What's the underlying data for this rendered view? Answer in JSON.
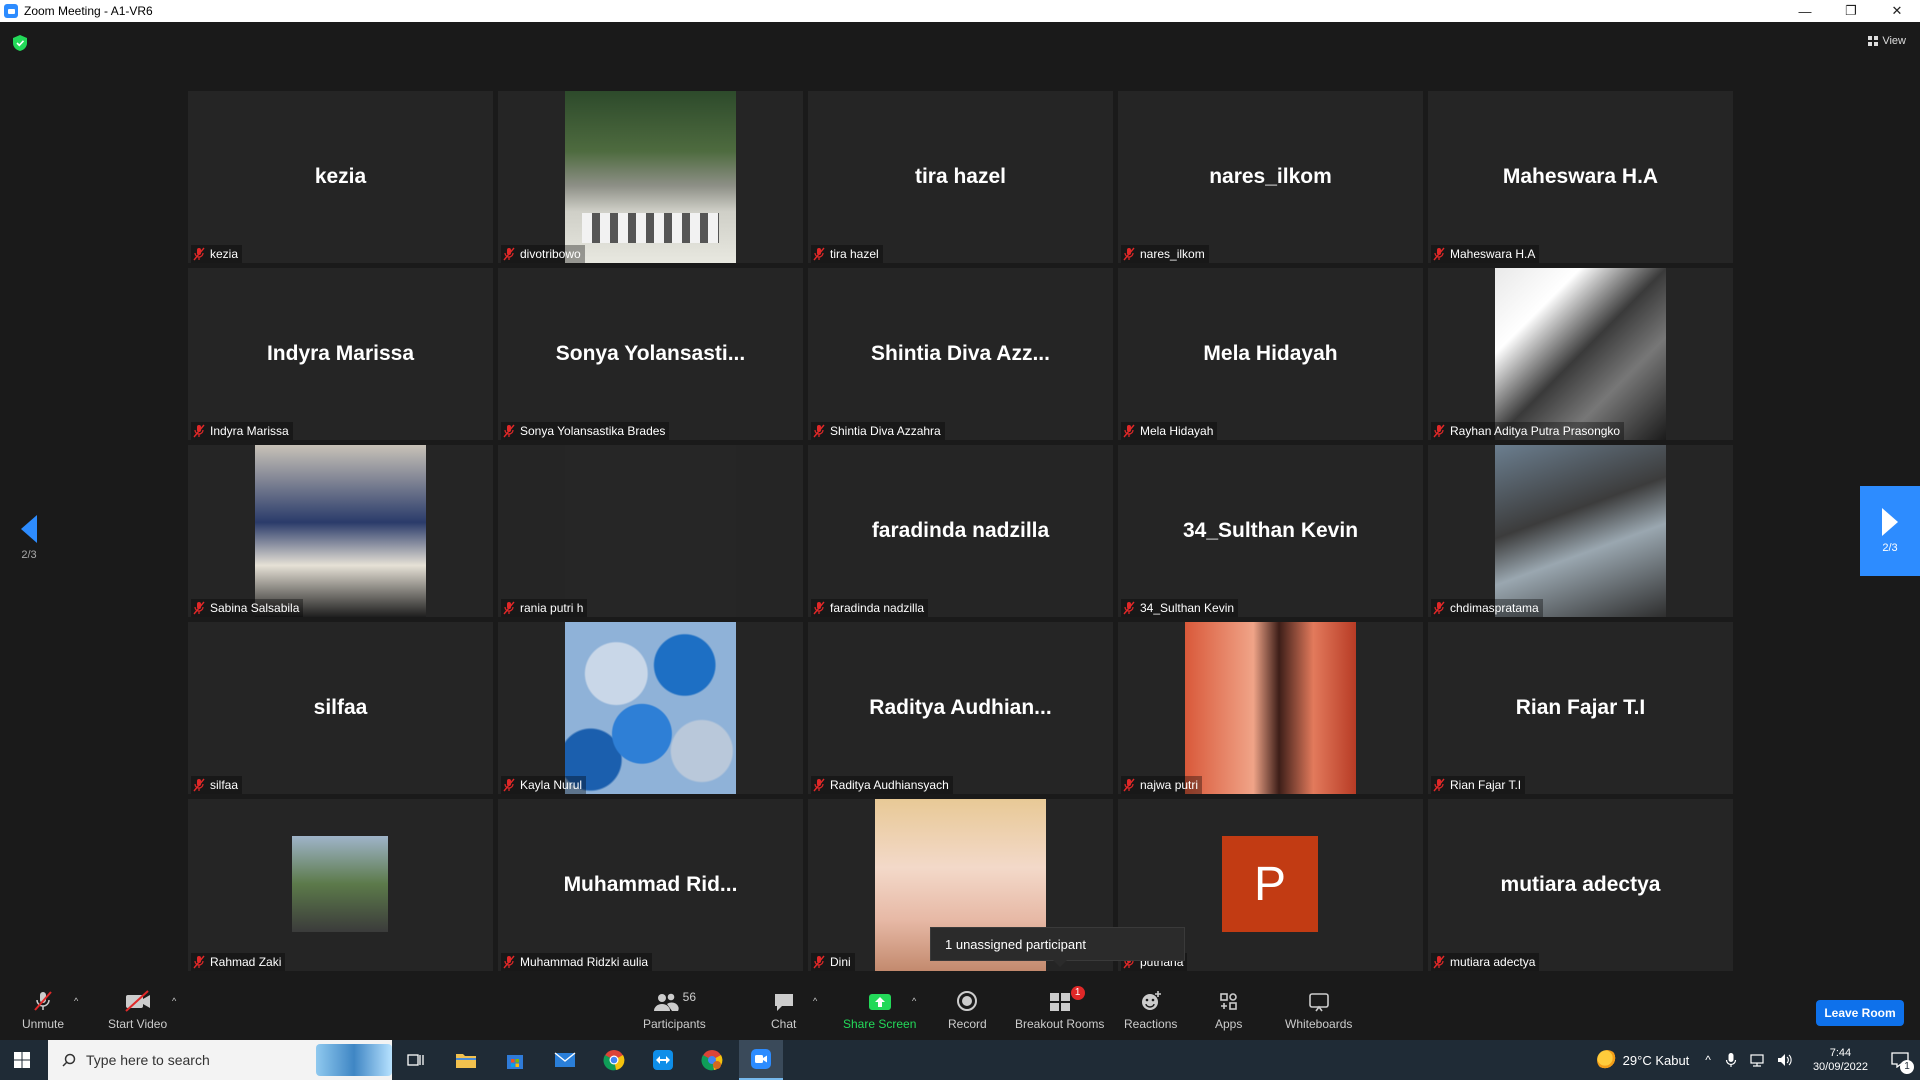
{
  "window": {
    "title": "Zoom Meeting - A1-VR6",
    "controls": [
      "—",
      "❐",
      "✕"
    ]
  },
  "view_button": "View",
  "tiles": [
    {
      "big": "kezia",
      "label": "kezia",
      "photo": ""
    },
    {
      "big": "",
      "label": "divotribowo",
      "photo": "p-abbey"
    },
    {
      "big": "tira hazel",
      "label": "tira hazel",
      "photo": ""
    },
    {
      "big": "nares_ilkom",
      "label": "nares_ilkom",
      "photo": ""
    },
    {
      "big": "Maheswara H.A",
      "label": "Maheswara H.A",
      "photo": ""
    },
    {
      "big": "Indyra Marissa",
      "label": "Indyra Marissa",
      "photo": ""
    },
    {
      "big": "Sonya  Yolansasti...",
      "label": "Sonya Yolansastika Brades",
      "photo": ""
    },
    {
      "big": "Shintia  Diva  Azz...",
      "label": "Shintia Diva Azzahra",
      "photo": ""
    },
    {
      "big": "Mela Hidayah",
      "label": "Mela Hidayah",
      "photo": ""
    },
    {
      "big": "",
      "label": "Rayhan Aditya Putra Prasongko",
      "photo": "p-rayhan"
    },
    {
      "big": "",
      "label": "Sabina Salsabila",
      "photo": "p-sabina"
    },
    {
      "big": "",
      "label": "rania putri h",
      "photo": "p-rania"
    },
    {
      "big": "faradinda nadzilla",
      "label": "faradinda nadzilla",
      "photo": ""
    },
    {
      "big": "34_Sulthan Kevin",
      "label": "34_Sulthan Kevin",
      "photo": ""
    },
    {
      "big": "",
      "label": "chdimaspratama",
      "photo": "p-chdimas"
    },
    {
      "big": "silfaa",
      "label": "silfaa",
      "photo": ""
    },
    {
      "big": "",
      "label": "Kayla Nurul",
      "photo": "p-kayla"
    },
    {
      "big": "Raditya  Audhian...",
      "label": "Raditya Audhiansyach",
      "photo": ""
    },
    {
      "big": "",
      "label": "najwa putri",
      "photo": "p-najwa"
    },
    {
      "big": "Rian Fajar T.I",
      "label": "Rian Fajar T.I",
      "photo": ""
    },
    {
      "big": "",
      "label": "Rahmad Zaki",
      "photo": "p-rahmad"
    },
    {
      "big": "Muhammad  Rid...",
      "label": "Muhammad Ridzki aulia",
      "photo": ""
    },
    {
      "big": "",
      "label": "Dini",
      "photo": "p-dini"
    },
    {
      "big": "",
      "label": "putriana",
      "photo": "p-putri",
      "avatar_letter": "P"
    },
    {
      "big": "mutiara adectya",
      "label": "mutiara adectya",
      "photo": ""
    }
  ],
  "pagination": {
    "left": "2/3",
    "right": "2/3"
  },
  "tooltip": "1 unassigned participant",
  "toolbar": {
    "unmute": "Unmute",
    "start_video": "Start Video",
    "participants": "Participants",
    "participants_count": "56",
    "chat": "Chat",
    "share_screen": "Share Screen",
    "record": "Record",
    "breakout_rooms": "Breakout Rooms",
    "breakout_badge": "1",
    "reactions": "Reactions",
    "apps": "Apps",
    "whiteboards": "Whiteboards",
    "leave": "Leave Room"
  },
  "taskbar": {
    "search_placeholder": "Type here to search",
    "weather": "29°C  Kabut",
    "time": "7:44",
    "date": "30/09/2022",
    "notification_count": "1"
  },
  "colors": {
    "accent": "#2d8cff",
    "share_green": "#23d959",
    "leave_blue": "#0e71eb",
    "mic_off_red": "#e02828"
  }
}
